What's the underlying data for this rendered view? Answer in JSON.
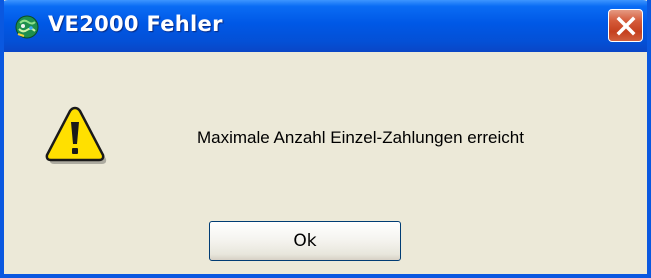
{
  "window": {
    "title": "VE2000 Fehler",
    "app_icon": "globe-icon",
    "close_icon": "close-icon"
  },
  "dialog": {
    "icon": "warning-icon",
    "message": "Maximale Anzahl Einzel-Zahlungen erreicht",
    "ok_label": "Ok"
  },
  "colors": {
    "titlebar": "#0058E6",
    "close_button": "#C5401E",
    "background": "#ECE9D8",
    "warning_fill": "#FFE000"
  }
}
